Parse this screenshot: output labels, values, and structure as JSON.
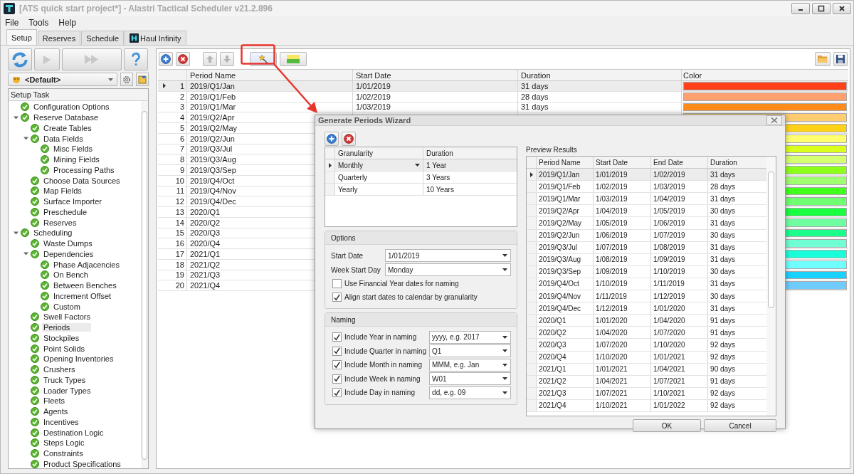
{
  "window": {
    "title": "[ATS quick start project*] - Alastri Tactical Scheduler v21.2.896"
  },
  "menu": [
    "File",
    "Tools",
    "Help"
  ],
  "tabs": [
    {
      "label": "Setup",
      "selected": true,
      "kind": "plain"
    },
    {
      "label": "Reserves",
      "selected": false,
      "kind": "plain"
    },
    {
      "label": "Schedule",
      "selected": false,
      "kind": "plain"
    },
    {
      "label": "Haul Infinity",
      "selected": false,
      "kind": "logo"
    }
  ],
  "profile": {
    "value": "<Default>"
  },
  "setup_tree": {
    "header": "Setup Task",
    "items": [
      {
        "label": "Configuration Options",
        "selected": false
      },
      {
        "label": "Reserve Database",
        "selected": false,
        "expanded": true,
        "children": [
          {
            "label": "Create Tables",
            "selected": false
          },
          {
            "label": "Data Fields",
            "selected": false,
            "expanded": true,
            "children": [
              {
                "label": "Misc Fields",
                "selected": false
              },
              {
                "label": "Mining Fields",
                "selected": false
              },
              {
                "label": "Processing Paths",
                "selected": false
              }
            ]
          },
          {
            "label": "Choose Data Sources",
            "selected": false
          },
          {
            "label": "Map Fields",
            "selected": false
          },
          {
            "label": "Surface Importer",
            "selected": false
          },
          {
            "label": "Preschedule",
            "selected": false
          },
          {
            "label": "Reserves",
            "selected": false
          }
        ]
      },
      {
        "label": "Scheduling",
        "selected": false,
        "expanded": true,
        "children": [
          {
            "label": "Waste Dumps",
            "selected": false
          },
          {
            "label": "Dependencies",
            "selected": false,
            "expanded": true,
            "children": [
              {
                "label": "Phase Adjacencies",
                "selected": false
              },
              {
                "label": "On Bench",
                "selected": false
              },
              {
                "label": "Between Benches",
                "selected": false
              },
              {
                "label": "Increment Offset",
                "selected": false
              },
              {
                "label": "Custom",
                "selected": false
              }
            ]
          },
          {
            "label": "Swell Factors",
            "selected": false
          },
          {
            "label": "Periods",
            "selected": true
          },
          {
            "label": "Stockpiles",
            "selected": false
          },
          {
            "label": "Point Solids",
            "selected": false
          },
          {
            "label": "Opening Inventories",
            "selected": false
          },
          {
            "label": "Crushers",
            "selected": false
          },
          {
            "label": "Truck Types",
            "selected": false
          },
          {
            "label": "Loader Types",
            "selected": false
          },
          {
            "label": "Fleets",
            "selected": false
          },
          {
            "label": "Agents",
            "selected": false
          },
          {
            "label": "Incentives",
            "selected": false
          },
          {
            "label": "Destination Logic",
            "selected": false
          },
          {
            "label": "Steps Logic",
            "selected": false
          },
          {
            "label": "Constraints",
            "selected": false
          },
          {
            "label": "Product Specifications",
            "selected": false
          }
        ]
      }
    ]
  },
  "periods_table": {
    "columns": [
      "Period Name",
      "Start Date",
      "Duration",
      "Color"
    ],
    "rows": [
      {
        "index": "1",
        "name": "2019/Q1/Jan",
        "start_date": "1/01/2019",
        "duration": "31 days",
        "color": "#ff4019",
        "selected": true
      },
      {
        "index": "2",
        "name": "2019/Q1/Feb",
        "start_date": "1/02/2019",
        "duration": "28 days",
        "color": "#ffa070",
        "selected": false
      },
      {
        "index": "3",
        "name": "2019/Q1/Mar",
        "start_date": "1/03/2019",
        "duration": "31 days",
        "color": "#ff8c1a",
        "selected": false
      },
      {
        "index": "4",
        "name": "2019/Q2/Apr",
        "color": "#ffcc70",
        "selected": false
      },
      {
        "index": "5",
        "name": "2019/Q2/May",
        "color": "#ffd21a",
        "selected": false
      },
      {
        "index": "6",
        "name": "2019/Q2/Jun",
        "color": "#ffff70",
        "selected": false
      },
      {
        "index": "7",
        "name": "2019/Q3/Jul",
        "color": "#d9ff1a",
        "selected": false
      },
      {
        "index": "8",
        "name": "2019/Q3/Aug",
        "color": "#d4ff70",
        "selected": false
      },
      {
        "index": "9",
        "name": "2019/Q3/Sep",
        "color": "#8cff1a",
        "selected": false
      },
      {
        "index": "10",
        "name": "2019/Q4/Oct",
        "color": "#a0ff70",
        "selected": false
      },
      {
        "index": "11",
        "name": "2019/Q4/Nov",
        "color": "#40ff1a",
        "selected": false
      },
      {
        "index": "12",
        "name": "2019/Q4/Dec",
        "color": "#70ff70",
        "selected": false
      },
      {
        "index": "13",
        "name": "2020/Q1",
        "color": "#1aff40",
        "selected": false
      },
      {
        "index": "14",
        "name": "2020/Q2",
        "color": "#70ffa0",
        "selected": false
      },
      {
        "index": "15",
        "name": "2020/Q3",
        "color": "#1aff8c",
        "selected": false
      },
      {
        "index": "16",
        "name": "2020/Q4",
        "color": "#70ffd4",
        "selected": false
      },
      {
        "index": "17",
        "name": "2021/Q1",
        "color": "#1affd9",
        "selected": false
      },
      {
        "index": "18",
        "name": "2021/Q2",
        "color": "#70ffff",
        "selected": false
      },
      {
        "index": "19",
        "name": "2021/Q3",
        "color": "#1ad2ff",
        "selected": false
      },
      {
        "index": "20",
        "name": "2021/Q4",
        "color": "#70ccff",
        "selected": false
      }
    ]
  },
  "wizard": {
    "title": "Generate Periods Wizard",
    "granularity_grid": {
      "columns": [
        "Granularity",
        "Duration"
      ],
      "rows": [
        {
          "granularity": "Monthly",
          "duration": "1 Year",
          "selected": true
        },
        {
          "granularity": "Quarterly",
          "duration": "3 Years",
          "selected": false
        },
        {
          "granularity": "Yearly",
          "duration": "10 Years",
          "selected": false
        }
      ]
    },
    "options": {
      "title": "Options",
      "start_date": {
        "label": "Start Date",
        "value": "1/01/2019"
      },
      "week_start_day": {
        "label": "Week Start Day",
        "value": "Monday"
      },
      "checkboxes": [
        {
          "label": "Use Financial Year dates for naming",
          "checked": false
        },
        {
          "label": "Align start dates to calendar by granularity",
          "checked": true
        }
      ]
    },
    "naming": {
      "title": "Naming",
      "items": [
        {
          "label": "Include Year in naming",
          "checked": true,
          "format": "yyyy, e.g. 2017"
        },
        {
          "label": "Include Quarter in naming",
          "checked": true,
          "format": "Q1"
        },
        {
          "label": "Include Month in naming",
          "checked": true,
          "format": "MMM, e.g. Jan"
        },
        {
          "label": "Include Week in naming",
          "checked": true,
          "format": "W01"
        },
        {
          "label": "Include Day in naming",
          "checked": true,
          "format": "dd, e.g. 09"
        }
      ]
    },
    "preview": {
      "title": "Preview Results",
      "columns": [
        "Period Name",
        "Start Date",
        "End Date",
        "Duration"
      ],
      "rows": [
        {
          "name": "2019/Q1/Jan",
          "start": "1/01/2019",
          "end": "1/02/2019",
          "duration": "31 days",
          "selected": true
        },
        {
          "name": "2019/Q1/Feb",
          "start": "1/02/2019",
          "end": "1/03/2019",
          "duration": "28 days",
          "selected": false
        },
        {
          "name": "2019/Q1/Mar",
          "start": "1/03/2019",
          "end": "1/04/2019",
          "duration": "31 days",
          "selected": false
        },
        {
          "name": "2019/Q2/Apr",
          "start": "1/04/2019",
          "end": "1/05/2019",
          "duration": "30 days",
          "selected": false
        },
        {
          "name": "2019/Q2/May",
          "start": "1/05/2019",
          "end": "1/06/2019",
          "duration": "31 days",
          "selected": false
        },
        {
          "name": "2019/Q2/Jun",
          "start": "1/06/2019",
          "end": "1/07/2019",
          "duration": "30 days",
          "selected": false
        },
        {
          "name": "2019/Q3/Jul",
          "start": "1/07/2019",
          "end": "1/08/2019",
          "duration": "31 days",
          "selected": false
        },
        {
          "name": "2019/Q3/Aug",
          "start": "1/08/2019",
          "end": "1/09/2019",
          "duration": "31 days",
          "selected": false
        },
        {
          "name": "2019/Q3/Sep",
          "start": "1/09/2019",
          "end": "1/10/2019",
          "duration": "30 days",
          "selected": false
        },
        {
          "name": "2019/Q4/Oct",
          "start": "1/10/2019",
          "end": "1/11/2019",
          "duration": "31 days",
          "selected": false
        },
        {
          "name": "2019/Q4/Nov",
          "start": "1/11/2019",
          "end": "1/12/2019",
          "duration": "30 days",
          "selected": false
        },
        {
          "name": "2019/Q4/Dec",
          "start": "1/12/2019",
          "end": "1/01/2020",
          "duration": "31 days",
          "selected": false
        },
        {
          "name": "2020/Q1",
          "start": "1/01/2020",
          "end": "1/04/2020",
          "duration": "91 days",
          "selected": false
        },
        {
          "name": "2020/Q2",
          "start": "1/04/2020",
          "end": "1/07/2020",
          "duration": "91 days",
          "selected": false
        },
        {
          "name": "2020/Q3",
          "start": "1/07/2020",
          "end": "1/10/2020",
          "duration": "92 days",
          "selected": false
        },
        {
          "name": "2020/Q4",
          "start": "1/10/2020",
          "end": "1/01/2021",
          "duration": "92 days",
          "selected": false
        },
        {
          "name": "2021/Q1",
          "start": "1/01/2021",
          "end": "1/04/2021",
          "duration": "90 days",
          "selected": false
        },
        {
          "name": "2021/Q2",
          "start": "1/04/2021",
          "end": "1/07/2021",
          "duration": "91 days",
          "selected": false
        },
        {
          "name": "2021/Q3",
          "start": "1/07/2021",
          "end": "1/10/2021",
          "duration": "92 days",
          "selected": false
        },
        {
          "name": "2021/Q4",
          "start": "1/10/2021",
          "end": "1/01/2022",
          "duration": "92 days",
          "selected": false
        }
      ]
    },
    "buttons": [
      "OK",
      "Cancel"
    ]
  }
}
